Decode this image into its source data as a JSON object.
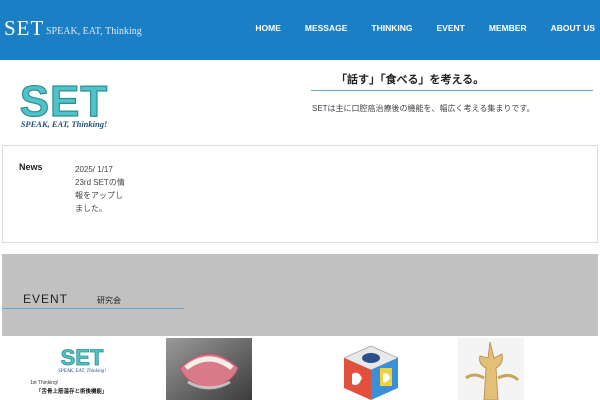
{
  "header": {
    "brand": "SET",
    "tagline": "SPEAK, EAT, Thinking",
    "nav": [
      "HOME",
      "MESSAGE",
      "THINKING",
      "EVENT",
      "MEMBER",
      "ABOUT US"
    ]
  },
  "hero": {
    "logo_text": "SET",
    "logo_tagline": "SPEAK, EAT, Thinking!",
    "heading": "「話す」「食べる」を考える。",
    "subtext": "SETは主に口腔癌治療後の機能を、幅広く考える集まりです。"
  },
  "news": {
    "label": "News",
    "date": "2025/ 1/17",
    "lines": [
      "23rd SETの情",
      "報をアップし",
      "ました。"
    ]
  },
  "event": {
    "title": "EVENT",
    "subtitle": "研究会"
  },
  "thumbnails": {
    "first": {
      "logo_text": "SET",
      "logo_tagline": "SPEAK, EAT, Thinking!",
      "caption_line1": "1st Thinking!",
      "caption_line2": "「舌骨上筋温存と術後機能」"
    }
  },
  "colors": {
    "header_bg": "#1a7fc5",
    "accent_rule": "#6aa6d4",
    "event_bg": "#c1c1c1",
    "logo_fill": "#4fc3c8"
  }
}
